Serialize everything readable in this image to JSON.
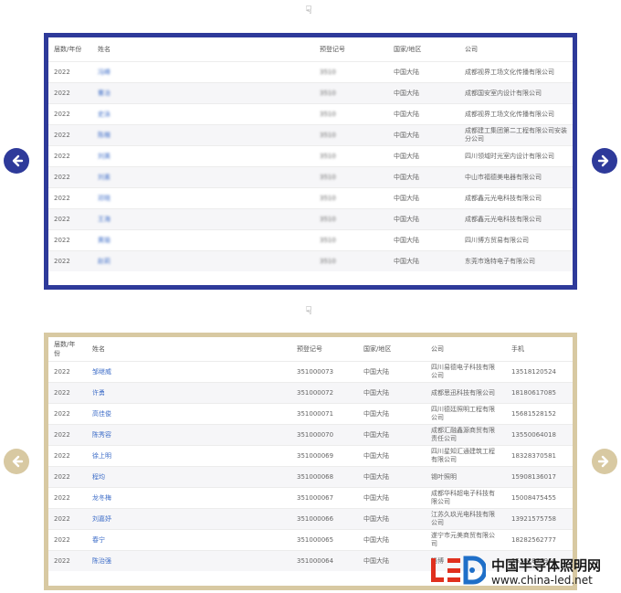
{
  "hand_icon_1": "☟",
  "hand_icon_2": "☟",
  "table1": {
    "headers": [
      "届数/年份",
      "姓名",
      "预登记号",
      "国家/地区",
      "公司"
    ],
    "rows": [
      [
        "2022",
        "冯峰",
        "3510",
        "中国大陆",
        "成都视界工场文化传播有限公司"
      ],
      [
        "2022",
        "曹冶",
        "3510",
        "中国大陆",
        "成都国安室内设计有限公司"
      ],
      [
        "2022",
        "史泳",
        "3510",
        "中国大陆",
        "成都视界工场文化传播有限公司"
      ],
      [
        "2022",
        "陈楷",
        "3510",
        "中国大陆",
        "成都建工集团第二工程有限公司安装分公司"
      ],
      [
        "2022",
        "刘美",
        "3510",
        "中国大陆",
        "四川领域时光室内设计有限公司"
      ],
      [
        "2022",
        "刘素",
        "3510",
        "中国大陆",
        "中山市福德美电器有限公司"
      ],
      [
        "2022",
        "邓晓",
        "3510",
        "中国大陆",
        "成都鑫元光电科技有限公司"
      ],
      [
        "2022",
        "王海",
        "3510",
        "中国大陆",
        "成都鑫元光电科技有限公司"
      ],
      [
        "2022",
        "黄瑜",
        "3510",
        "中国大陆",
        "四川博方贸易有限公司"
      ],
      [
        "2022",
        "赵莉",
        "3510",
        "中国大陆",
        "东莞市逸特电子有限公司"
      ]
    ]
  },
  "table2": {
    "headers": [
      "届数/年份",
      "姓名",
      "预登记号",
      "国家/地区",
      "公司",
      "手机"
    ],
    "rows": [
      [
        "2022",
        "邹继威",
        "351000073",
        "中国大陆",
        "四川易德电子科技有限公司",
        "13518120524"
      ],
      [
        "2022",
        "许勇",
        "351000072",
        "中国大陆",
        "成都思迅科技有限公司",
        "18180617085"
      ],
      [
        "2022",
        "高佳俊",
        "351000071",
        "中国大陆",
        "四川德廷照明工程有限公司",
        "15681528152"
      ],
      [
        "2022",
        "陈秀容",
        "351000070",
        "中国大陆",
        "成都汇融鑫源商贸有限责任公司",
        "13550064018"
      ],
      [
        "2022",
        "徐上明",
        "351000069",
        "中国大陆",
        "四川星知汇通建筑工程有限公司",
        "18328370581"
      ],
      [
        "2022",
        "程均",
        "351000068",
        "中国大陆",
        "锡叶照明",
        "15908136017"
      ],
      [
        "2022",
        "龙冬梅",
        "351000067",
        "中国大陆",
        "成都华科超电子科技有限公司",
        "15008475455"
      ],
      [
        "2022",
        "刘嘉妤",
        "351000066",
        "中国大陆",
        "江苏久玖光电科技有限公司",
        "13921575758"
      ],
      [
        "2022",
        "春宁",
        "351000065",
        "中国大陆",
        "遂宁市元美商贸有限公司",
        "18282562777"
      ],
      [
        "2022",
        "陈治强",
        "351000064",
        "中国大陆",
        "淄博",
        "15302877966"
      ]
    ]
  },
  "logo": {
    "mark": "LED",
    "name_cn": "中国半导体照明网",
    "url": "www.china-led.net"
  },
  "colors": {
    "blue_frame": "#2e3a9a",
    "gold_frame": "#d8c9a2",
    "link_blue": "#3f6ec8",
    "logo_red": "#e0301e",
    "logo_blue": "#1f6fc8"
  }
}
